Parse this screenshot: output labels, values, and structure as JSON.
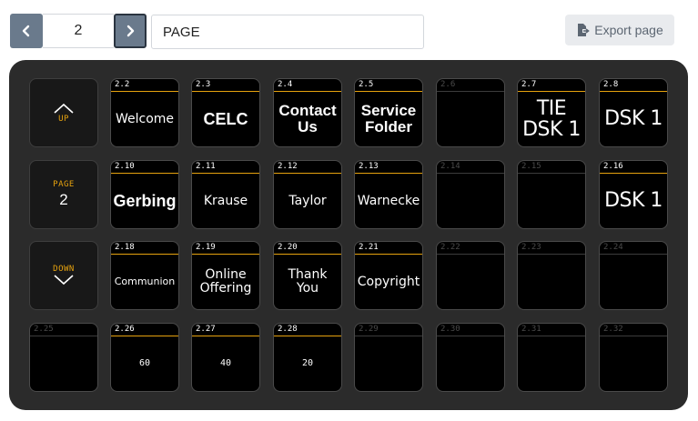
{
  "toolbar": {
    "page_number": "2",
    "page_name": "PAGE",
    "export_label": "Export page"
  },
  "nav_keys": {
    "up_label": "UP",
    "page_label": "PAGE",
    "page_value": "2",
    "down_label": "DOWN"
  },
  "buttons": [
    {
      "id": "2.2",
      "text": "Welcome",
      "style": "normal",
      "size": 14
    },
    {
      "id": "2.3",
      "text": "CELC",
      "style": "bold",
      "size": 18
    },
    {
      "id": "2.4",
      "text": "Contact\nUs",
      "style": "bold",
      "size": 17
    },
    {
      "id": "2.5",
      "text": "Service\nFolder",
      "style": "bold",
      "size": 17
    },
    {
      "id": "2.6",
      "text": "",
      "style": "empty",
      "size": 14
    },
    {
      "id": "2.7",
      "text": "TIE\nDSK 1",
      "style": "normal",
      "size": 22
    },
    {
      "id": "2.8",
      "text": "DSK 1",
      "style": "normal",
      "size": 22
    },
    {
      "id": "2.10",
      "text": "Gerbing",
      "style": "bold",
      "size": 18
    },
    {
      "id": "2.11",
      "text": "Krause",
      "style": "normal",
      "size": 14
    },
    {
      "id": "2.12",
      "text": "Taylor",
      "style": "normal",
      "size": 14
    },
    {
      "id": "2.13",
      "text": "Warnecke",
      "style": "normal",
      "size": 14
    },
    {
      "id": "2.14",
      "text": "",
      "style": "empty",
      "size": 14
    },
    {
      "id": "2.15",
      "text": "",
      "style": "empty",
      "size": 14
    },
    {
      "id": "2.16",
      "text": "DSK 1",
      "style": "normal",
      "size": 22
    },
    {
      "id": "2.18",
      "text": "Communion",
      "style": "normal",
      "size": 11
    },
    {
      "id": "2.19",
      "text": "Online\nOffering",
      "style": "normal",
      "size": 14
    },
    {
      "id": "2.20",
      "text": "Thank\nYou",
      "style": "normal",
      "size": 14
    },
    {
      "id": "2.21",
      "text": "Copyright",
      "style": "normal",
      "size": 14
    },
    {
      "id": "2.22",
      "text": "",
      "style": "empty",
      "size": 14
    },
    {
      "id": "2.23",
      "text": "",
      "style": "empty",
      "size": 14
    },
    {
      "id": "2.24",
      "text": "",
      "style": "empty",
      "size": 14
    },
    {
      "id": "2.25",
      "text": "",
      "style": "empty",
      "size": 14
    },
    {
      "id": "2.26",
      "text": "60",
      "style": "mono",
      "size": 10
    },
    {
      "id": "2.27",
      "text": "40",
      "style": "mono",
      "size": 10
    },
    {
      "id": "2.28",
      "text": "20",
      "style": "mono",
      "size": 10
    },
    {
      "id": "2.29",
      "text": "",
      "style": "empty",
      "size": 14
    },
    {
      "id": "2.30",
      "text": "",
      "style": "empty",
      "size": 14
    },
    {
      "id": "2.31",
      "text": "",
      "style": "empty",
      "size": 14
    },
    {
      "id": "2.32",
      "text": "",
      "style": "empty",
      "size": 14
    }
  ],
  "colors": {
    "accent": "#e6a20e",
    "panel": "#2b2b2b",
    "nav_button": "#6a7a8c"
  }
}
